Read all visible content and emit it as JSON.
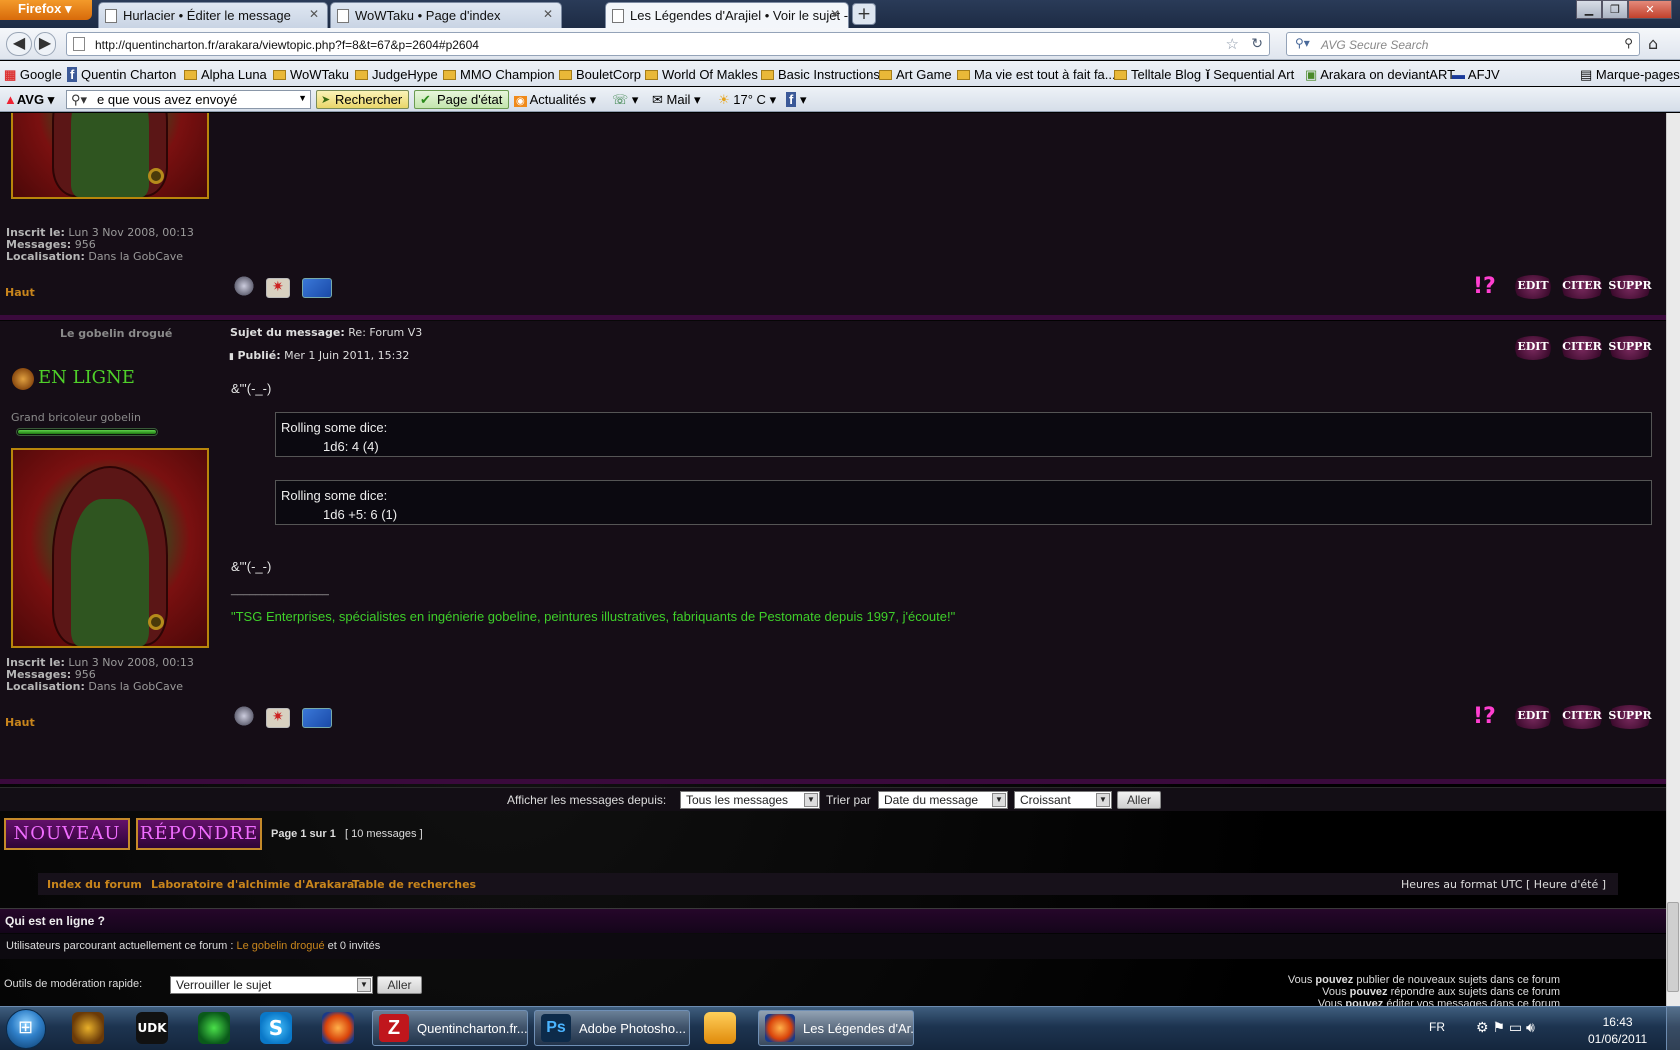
{
  "browser": {
    "app_button": "Firefox",
    "tabs": [
      {
        "label": "Hurlacier • Éditer le message"
      },
      {
        "label": "WoWTaku • Page d'index"
      },
      {
        "label": "Les Légendes d'Arajiel • Voir le sujet -..."
      }
    ],
    "url": "http://quentincharton.fr/arakara/viewtopic.php?f=8&t=67&p=2604#p2604",
    "search_placeholder": "AVG Secure Search",
    "bookmarks": [
      "Google",
      "Quentin Charton",
      "Alpha Luna",
      "WoWTaku",
      "JudgeHype",
      "MMO Champion",
      "BouletCorp",
      "World Of Makles",
      "Basic Instructions",
      "Art Game",
      "Ma vie est tout à fait fa...",
      "Telltale Blog",
      "Sequential Art",
      "Arakara on deviantART",
      "AFJV"
    ],
    "bookmarks_menu": "Marque-pages",
    "avg": {
      "brand": "AVG",
      "search_value": "e que vous avez envoyé",
      "search_button": "Rechercher",
      "page_state": "Page d'état",
      "news": "Actualités",
      "mail": "Mail",
      "weather": "17° C"
    }
  },
  "post1": {
    "profile": {
      "joined_label": "Inscrit le:",
      "joined": "Lun 3 Nov 2008, 00:13",
      "messages_label": "Messages:",
      "messages": "956",
      "location_label": "Localisation:",
      "location": "Dans la GobCave"
    },
    "top_link": "Haut"
  },
  "post2": {
    "author": "Le gobelin drogué",
    "online": "EN LIGNE",
    "rank": "Grand bricoleur gobelin",
    "subject_label": "Sujet du message:",
    "subject": "Re: Forum V3",
    "published_label": "Publié:",
    "published": "Mer 1 Juin 2011, 15:32",
    "line1": "&\"'(-_-)",
    "dice": [
      {
        "title": "Rolling some dice:",
        "result": "1d6: 4 (4)"
      },
      {
        "title": "Rolling some dice:",
        "result": "1d6 +5: 6 (1)"
      }
    ],
    "line2": "&\"'(-_-)",
    "sig_rule": "________________",
    "signature": "\"TSG Enterprises, spécialistes en ingénierie gobeline, peintures illustratives, fabriquants de Pestomate depuis 1997, j'écoute!\"",
    "profile": {
      "joined_label": "Inscrit le:",
      "joined": "Lun 3 Nov 2008, 00:13",
      "messages_label": "Messages:",
      "messages": "956",
      "location_label": "Localisation:",
      "location": "Dans la GobCave"
    },
    "top_link": "Haut"
  },
  "post_buttons": {
    "edit": "EDIT",
    "quote": "CITER",
    "delete": "SUPPR",
    "report": "!?"
  },
  "sort": {
    "show_label": "Afficher les messages depuis:",
    "show_value": "Tous les messages",
    "sort_label": "Trier par",
    "sort_value": "Date du message",
    "order_value": "Croissant",
    "go": "Aller"
  },
  "actions": {
    "new_topic": "NOUVEAU",
    "reply": "RÉPONDRE",
    "page_info": "Page 1 sur 1",
    "count": "[ 10 messages ]"
  },
  "nav": {
    "links": [
      "Index du forum",
      "Laboratoire d'alchimie d'Arakara",
      "Table de recherches"
    ],
    "timezone": "Heures au format UTC [ Heure d'été ]"
  },
  "whois": {
    "heading": "Qui est en ligne ?",
    "text_before": "Utilisateurs parcourant actuellement ce forum :",
    "user": "Le gobelin drogué",
    "text_after": "et 0 invités"
  },
  "moderation": {
    "label": "Outils de modération rapide:",
    "value": "Verrouiller le sujet",
    "go": "Aller"
  },
  "permissions": [
    {
      "pre": "Vous",
      "strong": "pouvez",
      "post": "publier de nouveaux sujets dans ce forum"
    },
    {
      "pre": "Vous",
      "strong": "pouvez",
      "post": "répondre aux sujets dans ce forum"
    },
    {
      "pre": "Vous",
      "strong": "pouvez",
      "post": "éditer vos messages dans ce forum"
    }
  ],
  "taskbar": {
    "tasks": [
      "Quentincharton.fr...",
      "Adobe Photosho...",
      "Les Légendes d'Ar..."
    ],
    "lang": "FR",
    "time": "16:43",
    "date": "01/06/2011"
  },
  "colors": {
    "accent": "#c8851c",
    "online": "#4fd02a",
    "signature": "#3fcf2a",
    "button_text": "#f06cff"
  }
}
